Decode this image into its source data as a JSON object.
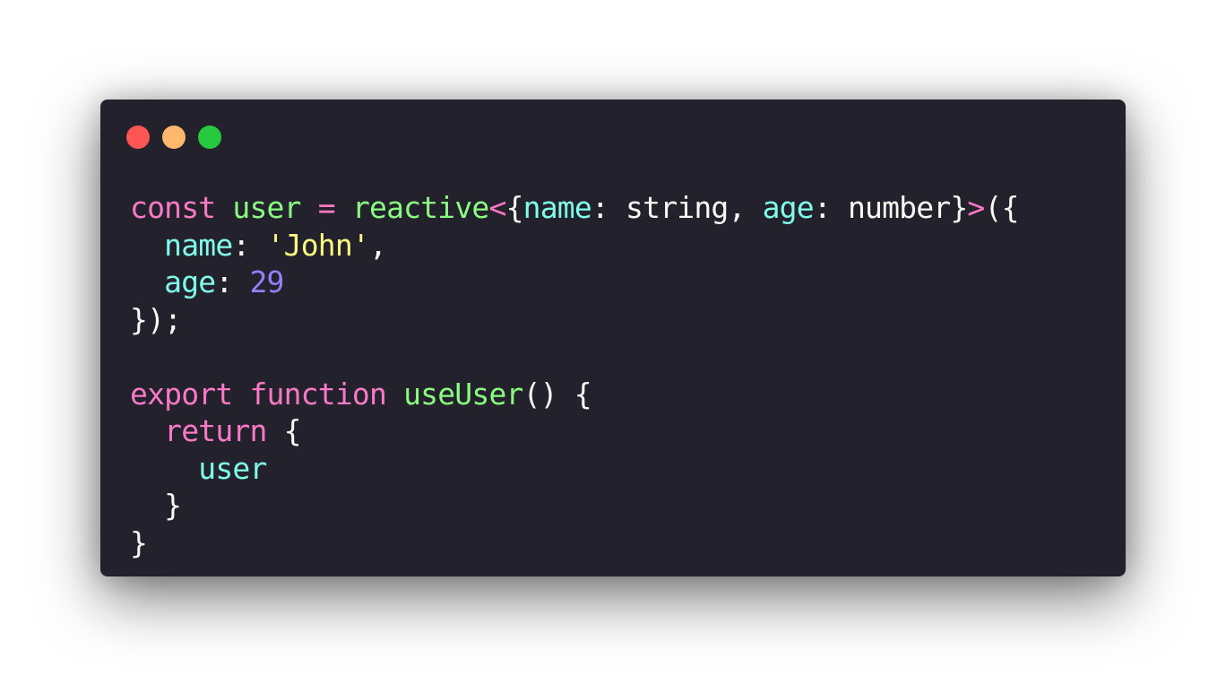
{
  "window": {
    "controls": [
      {
        "name": "close",
        "color": "#ff5555"
      },
      {
        "name": "minimize",
        "color": "#ffb86c"
      },
      {
        "name": "maximize",
        "color": "#27c93f"
      }
    ]
  },
  "colors": {
    "background": "#22212c",
    "keyword": "#ff79c6",
    "identifier": "#8aff80",
    "property": "#80ffea",
    "string": "#ffff80",
    "number": "#9580ff",
    "plain": "#f8f8f2"
  },
  "code": {
    "lines": [
      [
        {
          "t": "const",
          "k": "keyword"
        },
        {
          "t": " ",
          "k": "plain"
        },
        {
          "t": "user",
          "k": "identifier"
        },
        {
          "t": " ",
          "k": "plain"
        },
        {
          "t": "=",
          "k": "keyword"
        },
        {
          "t": " ",
          "k": "plain"
        },
        {
          "t": "reactive",
          "k": "identifier"
        },
        {
          "t": "<",
          "k": "keyword"
        },
        {
          "t": "{",
          "k": "plain"
        },
        {
          "t": "name",
          "k": "property"
        },
        {
          "t": ": string, ",
          "k": "plain"
        },
        {
          "t": "age",
          "k": "property"
        },
        {
          "t": ": number}",
          "k": "plain"
        },
        {
          "t": ">",
          "k": "keyword"
        },
        {
          "t": "({",
          "k": "plain"
        }
      ],
      [
        {
          "t": "  ",
          "k": "plain"
        },
        {
          "t": "name",
          "k": "property"
        },
        {
          "t": ": ",
          "k": "plain"
        },
        {
          "t": "'John'",
          "k": "string"
        },
        {
          "t": ",",
          "k": "plain"
        }
      ],
      [
        {
          "t": "  ",
          "k": "plain"
        },
        {
          "t": "age",
          "k": "property"
        },
        {
          "t": ": ",
          "k": "plain"
        },
        {
          "t": "29",
          "k": "number"
        }
      ],
      [
        {
          "t": "});",
          "k": "plain"
        }
      ],
      [],
      [
        {
          "t": "export",
          "k": "keyword"
        },
        {
          "t": " ",
          "k": "plain"
        },
        {
          "t": "function",
          "k": "keyword"
        },
        {
          "t": " ",
          "k": "plain"
        },
        {
          "t": "useUser",
          "k": "identifier"
        },
        {
          "t": "() {",
          "k": "plain"
        }
      ],
      [
        {
          "t": "  ",
          "k": "plain"
        },
        {
          "t": "return",
          "k": "keyword"
        },
        {
          "t": " {",
          "k": "plain"
        }
      ],
      [
        {
          "t": "    ",
          "k": "plain"
        },
        {
          "t": "user",
          "k": "property"
        }
      ],
      [
        {
          "t": "  }",
          "k": "plain"
        }
      ],
      [
        {
          "t": "}",
          "k": "plain"
        }
      ]
    ]
  }
}
